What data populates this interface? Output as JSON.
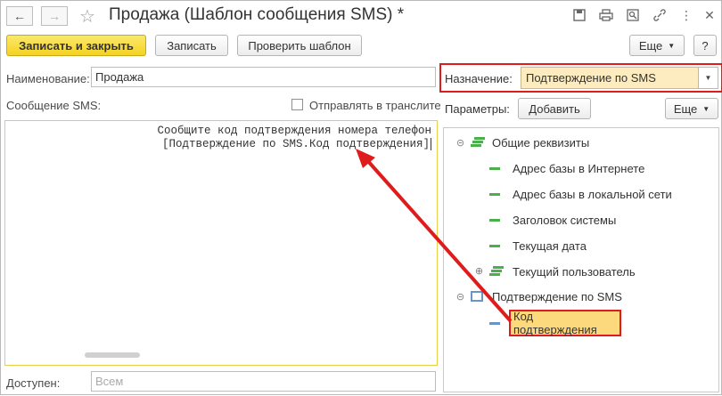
{
  "title": "Продажа (Шаблон сообщения SMS) *",
  "toolbar": {
    "save_close": "Записать и закрыть",
    "save": "Записать",
    "check_template": "Проверить шаблон",
    "more": "Еще"
  },
  "window_controls": {
    "help": "?"
  },
  "form": {
    "name_label": "Наименование:",
    "name_value": "Продажа",
    "purpose_label": "Назначение:",
    "purpose_value": "Подтверждение по SMS",
    "sms_label": "Сообщение SMS:",
    "translit_label": "Отправлять в транслите",
    "sms_lines": [
      "Сообщите код подтверждения номера телефон",
      "[Подтверждение по SMS.Код подтверждения]"
    ],
    "access_label": "Доступен:",
    "access_placeholder": "Всем"
  },
  "params": {
    "label": "Параметры:",
    "add": "Добавить",
    "more": "Еще"
  },
  "tree": {
    "group1": "Общие реквизиты",
    "group1_items": [
      "Адрес базы в Интернете",
      "Адрес базы в локальной сети",
      "Заголовок системы",
      "Текущая дата",
      "Текущий пользователь"
    ],
    "group2": "Подтверждение по SMS",
    "group2_items": [
      "Код подтверждения"
    ]
  },
  "colors": {
    "accent_yellow": "#f5d320",
    "highlight_red": "#e01b1b",
    "tree_green": "#4bb04b",
    "tree_blue": "#6a93c9"
  }
}
